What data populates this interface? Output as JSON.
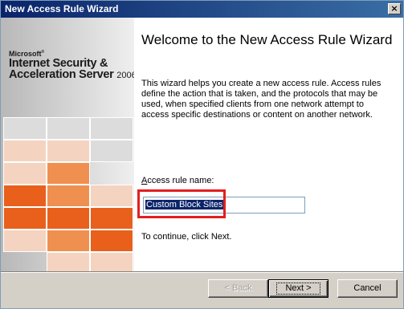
{
  "window": {
    "title": "New Access Rule Wizard",
    "close_glyph": "×"
  },
  "sidebar": {
    "logo": {
      "company": "Microsoft",
      "product_line1": "Internet Security &",
      "product_line2": "Acceleration Server",
      "version": "2006"
    },
    "tile_colors": {
      "orange": "#e8601c",
      "light_orange": "#f09050",
      "pale": "#f4d3c0",
      "grey": "#dcdcdc"
    }
  },
  "main": {
    "heading": "Welcome to the New Access Rule Wizard",
    "description": "This wizard helps you create a new access rule. Access rules define the action that is taken, and the protocols that may be used, when specified clients from one network attempt to access specific destinations or content on another network.",
    "rule_name_label_prefix": "A",
    "rule_name_label_rest": "ccess rule name:",
    "rule_name_value": "Custom Block Sites",
    "continue_text": "To continue, click Next.",
    "highlight_color": "#e41e1e"
  },
  "buttons": {
    "back_label": "< Back",
    "next_label": "Next >",
    "cancel_label": "Cancel"
  }
}
